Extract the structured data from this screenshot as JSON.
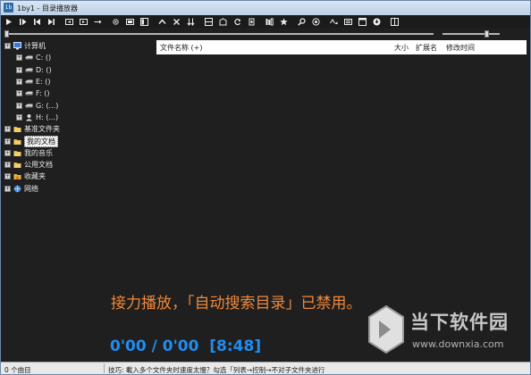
{
  "window": {
    "title": "1by1 - 目录播放器",
    "app_icon_text": "1b"
  },
  "toolbar": {
    "buttons": [
      {
        "name": "play-icon"
      },
      {
        "name": "play-pause-icon"
      },
      {
        "name": "previous-icon"
      },
      {
        "name": "next-icon"
      },
      {
        "name": "back-folder-icon"
      },
      {
        "name": "forward-folder-icon"
      },
      {
        "name": "goto-icon"
      },
      {
        "name": "settings-icon"
      },
      {
        "name": "compact-view-icon"
      },
      {
        "name": "panel-view-icon"
      },
      {
        "name": "up-icon"
      },
      {
        "name": "close-icon"
      },
      {
        "name": "sort-icon"
      },
      {
        "name": "playlist-icon"
      },
      {
        "name": "refresh-icon"
      },
      {
        "name": "repeat-icon"
      },
      {
        "name": "shuffle-icon"
      },
      {
        "name": "library-icon"
      },
      {
        "name": "favorite-icon"
      },
      {
        "name": "find-icon"
      },
      {
        "name": "find-next-icon"
      },
      {
        "name": "loop-ab-icon"
      },
      {
        "name": "equalizer-icon"
      },
      {
        "name": "window-icon"
      },
      {
        "name": "options-icon"
      },
      {
        "name": "mini-mode-icon"
      }
    ]
  },
  "progress": {
    "seek_fraction": 0.0,
    "volume_fraction": 0.78
  },
  "tree": {
    "nodes": [
      {
        "label": "计算机",
        "icon": "computer-icon",
        "level": 0,
        "selected": false
      },
      {
        "label": "C: ()",
        "icon": "drive-icon",
        "level": 1,
        "selected": false
      },
      {
        "label": "D: ()",
        "icon": "drive-icon",
        "level": 1,
        "selected": false
      },
      {
        "label": "E: ()",
        "icon": "drive-icon",
        "level": 1,
        "selected": false
      },
      {
        "label": "F: ()",
        "icon": "drive-icon",
        "level": 1,
        "selected": false
      },
      {
        "label": "G: (...)",
        "icon": "drive-icon",
        "level": 1,
        "selected": false
      },
      {
        "label": "H: (...)",
        "icon": "user-drive-icon",
        "level": 1,
        "selected": false
      },
      {
        "label": "基准文件夹",
        "icon": "folder-icon",
        "level": 0,
        "selected": false
      },
      {
        "label": "我的文档",
        "icon": "folder-icon",
        "level": 0,
        "selected": true
      },
      {
        "label": "我的音乐",
        "icon": "folder-icon",
        "level": 0,
        "selected": false
      },
      {
        "label": "公用文档",
        "icon": "folder-icon",
        "level": 0,
        "selected": false
      },
      {
        "label": "收藏夹",
        "icon": "favorites-folder-icon",
        "level": 0,
        "selected": false
      },
      {
        "label": "网络",
        "icon": "network-icon",
        "level": 0,
        "selected": false
      }
    ]
  },
  "filelist": {
    "columns": {
      "name": "文件名称 (+)",
      "size": "大小",
      "ext": "扩展名",
      "modified": "修改时间"
    }
  },
  "player": {
    "notice": "接力播放，「自动搜索目录」已禁用。",
    "time": "0'00 / 0'00",
    "total": "[8:48]"
  },
  "watermark": {
    "name": "当下软件园",
    "url": "www.downxia.com"
  },
  "status": {
    "count": "0 个曲目",
    "tip": "技巧: 載入多个文件夹时速度太慢？勾选「列表→控制→不对子文件夹进行"
  },
  "colors": {
    "notice": "#f0883a",
    "time": "#1f8df2",
    "background": "#1f1f1f"
  }
}
